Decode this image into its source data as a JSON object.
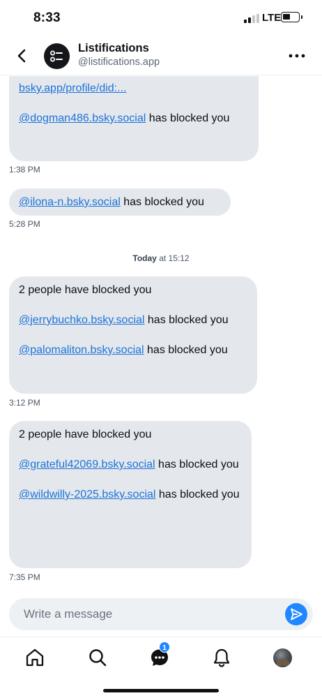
{
  "status_bar": {
    "time": "8:33",
    "network": "LTE"
  },
  "header": {
    "name": "Listifications",
    "handle": "@listifications.app"
  },
  "messages": {
    "m1": {
      "partial_link": "bsky.app/profile/did:...",
      "handle": "@dogman486.bsky.social",
      "suffix": " has blocked you",
      "time": "1:38 PM"
    },
    "m2": {
      "handle": "@ilona-n.bsky.social",
      "suffix": " has blocked you",
      "time": "5:28 PM"
    },
    "day_separator": {
      "day": "Today",
      "rest": " at 15:12"
    },
    "m3": {
      "lead": "2 people have blocked you",
      "handle1": "@jerrybuchko.bsky.social",
      "handle2": "@palomaliton.bsky.social",
      "suffix": " has blocked you",
      "time": "3:12 PM"
    },
    "m4": {
      "lead": "2 people have blocked you",
      "handle1": "@grateful42069.bsky.social",
      "handle2": "@wildwilly-2025.bsky.social",
      "suffix": " has blocked you",
      "time": "7:35 PM"
    }
  },
  "composer": {
    "placeholder": "Write a message"
  },
  "nav": {
    "chat_badge": "1"
  }
}
